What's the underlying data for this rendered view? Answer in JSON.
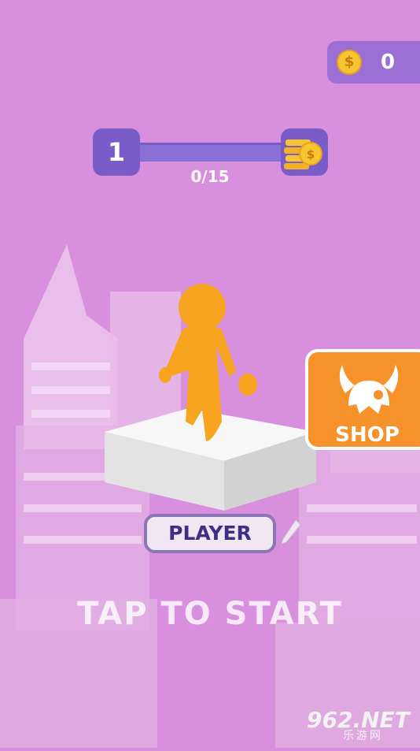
{
  "coins": {
    "icon": "dollar-coin-icon",
    "symbol": "$",
    "count": "0"
  },
  "progress": {
    "level": "1",
    "label": "0/15",
    "reward_icon": "coin-stack-icon",
    "reward_symbol": "$"
  },
  "shop": {
    "icon": "viking-helmet-icon",
    "label": "SHOP"
  },
  "player": {
    "name": "PLAYER",
    "edit_icon": "pencil-icon"
  },
  "prompt": {
    "text": "TAP TO START"
  },
  "watermark": {
    "brand": "962.NET",
    "sub": "乐游网"
  },
  "colors": {
    "background": "#d88fdd",
    "accent": "#7a5cc8",
    "shop": "#f7922a",
    "character": "#f7a521"
  }
}
